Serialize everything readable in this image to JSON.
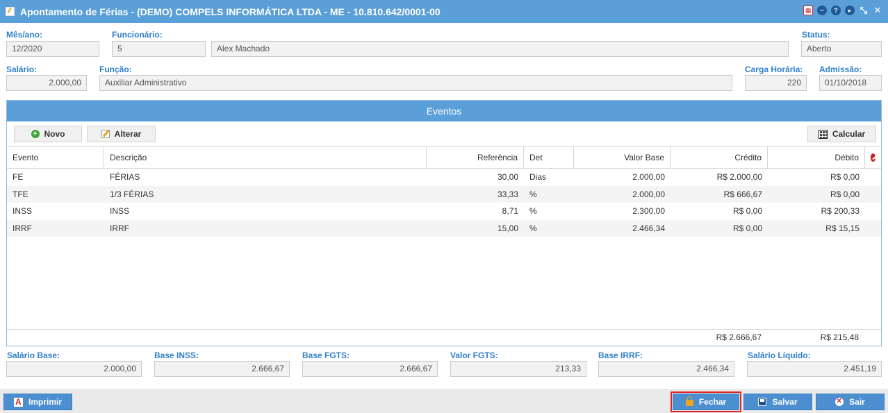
{
  "window": {
    "title": "Apontamento de Férias - (DEMO) COMPELS INFORMÁTICA LTDA - ME - 10.810.642/0001-00"
  },
  "header": {
    "mes_ano": {
      "label": "Mês/ano:",
      "value": "12/2020"
    },
    "funcionario": {
      "label": "Funcionário:",
      "code": "5",
      "name": "Alex Machado"
    },
    "status": {
      "label": "Status:",
      "value": "Aberto"
    },
    "salario": {
      "label": "Salário:",
      "value": "2.000,00"
    },
    "funcao": {
      "label": "Função:",
      "value": "Auxiliar Administrativo"
    },
    "carga_horaria": {
      "label": "Carga Horária:",
      "value": "220"
    },
    "admissao": {
      "label": "Admissão:",
      "value": "01/10/2018"
    }
  },
  "eventos": {
    "title": "Eventos",
    "toolbar": {
      "novo": "Novo",
      "alterar": "Alterar",
      "calcular": "Calcular"
    },
    "columns": [
      "Evento",
      "Descrição",
      "Referência",
      "Det",
      "Valor Base",
      "Crédito",
      "Débito"
    ],
    "rows": [
      {
        "evento": "FE",
        "descricao": "FÉRIAS",
        "referencia": "30,00",
        "det": "Dias",
        "valor_base": "2.000,00",
        "credito": "R$ 2.000,00",
        "debito": "R$ 0,00"
      },
      {
        "evento": "TFE",
        "descricao": "1/3 FÉRIAS",
        "referencia": "33,33",
        "det": "%",
        "valor_base": "2.000,00",
        "credito": "R$ 666,67",
        "debito": "R$ 0,00"
      },
      {
        "evento": "INSS",
        "descricao": "INSS",
        "referencia": "8,71",
        "det": "%",
        "valor_base": "2.300,00",
        "credito": "R$ 0,00",
        "debito": "R$ 200,33"
      },
      {
        "evento": "IRRF",
        "descricao": "IRRF",
        "referencia": "15,00",
        "det": "%",
        "valor_base": "2.466,34",
        "credito": "R$ 0,00",
        "debito": "R$ 15,15"
      }
    ],
    "totals": {
      "credito": "R$ 2.666,67",
      "debito": "R$ 215,48"
    }
  },
  "summary": {
    "salario_base": {
      "label": "Salário Base:",
      "value": "2.000,00"
    },
    "base_inss": {
      "label": "Base INSS:",
      "value": "2.666,67"
    },
    "base_fgts": {
      "label": "Base FGTS:",
      "value": "2.666,67"
    },
    "valor_fgts": {
      "label": "Valor FGTS:",
      "value": "213,33"
    },
    "base_irrf": {
      "label": "Base IRRF:",
      "value": "2.466,34"
    },
    "salario_liquido": {
      "label": "Salário Líquido:",
      "value": "2.451,19"
    }
  },
  "actions": {
    "imprimir": "Imprimir",
    "fechar": "Fechar",
    "salvar": "Salvar",
    "sair": "Sair"
  },
  "colors": {
    "accent": "#5b9fd9",
    "label": "#2f7fca",
    "button": "#4b8fd0",
    "highlight": "#e32222"
  }
}
